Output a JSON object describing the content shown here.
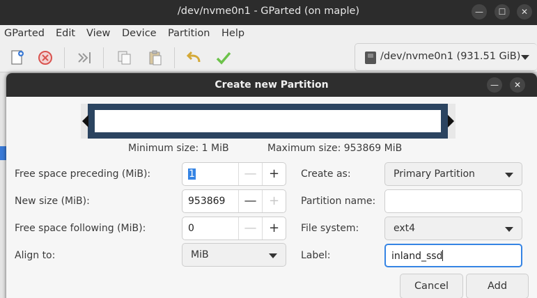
{
  "window": {
    "title": "/dev/nvme0n1 - GParted (on maple)"
  },
  "menubar": {
    "items": [
      "GParted",
      "Edit",
      "View",
      "Device",
      "Partition",
      "Help"
    ]
  },
  "toolbar": {
    "device_label": "/dev/nvme0n1 (931.51 GiB)"
  },
  "dialog": {
    "title": "Create new Partition",
    "min_size": "Minimum size: 1 MiB",
    "max_size": "Maximum size: 953869 MiB",
    "fields": {
      "free_preceding_label": "Free space preceding (MiB):",
      "free_preceding_value": "1",
      "new_size_label": "New size (MiB):",
      "new_size_value": "953869",
      "free_following_label": "Free space following (MiB):",
      "free_following_value": "0",
      "align_label": "Align to:",
      "align_value": "MiB",
      "create_as_label": "Create as:",
      "create_as_value": "Primary Partition",
      "partition_name_label": "Partition name:",
      "partition_name_value": "",
      "file_system_label": "File system:",
      "file_system_value": "ext4",
      "label_label": "Label:",
      "label_value": "inland_ssd"
    },
    "buttons": {
      "cancel": "Cancel",
      "add": "Add"
    }
  },
  "colors": {
    "partition_bar": "#2b4460",
    "focus": "#3584e4",
    "apply_check": "#4caf50",
    "undo_arrow": "#d4a938",
    "delete_red": "#d9534f"
  }
}
